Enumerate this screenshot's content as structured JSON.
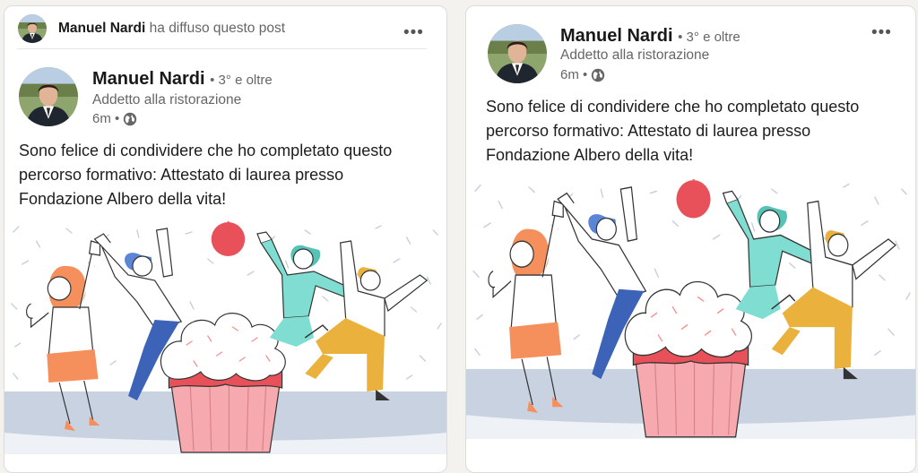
{
  "card1": {
    "repost": {
      "name": "Manuel Nardi",
      "action": "ha diffuso questo post"
    },
    "author": {
      "name": "Manuel Nardi",
      "degree": "• 3° e oltre",
      "headline": "Addetto alla ristorazione",
      "time": "6m •"
    },
    "text_lines": [
      "Sono felice di condividere che ho completato questo",
      "percorso formativo: Attestato di laurea presso",
      "Fondazione Albero della vita!"
    ],
    "more_label": "•••"
  },
  "card2": {
    "author": {
      "name": "Manuel Nardi",
      "degree": "• 3° e oltre",
      "headline": "Addetto alla ristorazione",
      "time": "6m •"
    },
    "text_lines": [
      "Sono felice di condividere che ho completato questo",
      "percorso formativo: Attestato di laurea presso",
      "Fondazione Albero della vita!"
    ],
    "more_label": "•••"
  },
  "icons": {
    "more": "more-horizontal-icon",
    "visibility": "globe-icon"
  },
  "colors": {
    "floor": "#c9d2e0",
    "cupcake_frosting": "#ffffff",
    "cupcake_base": "#f6a9ae",
    "cupcake_band": "#e8515a",
    "cherry": "#e8515a",
    "accent_orange": "#f58f5c",
    "accent_blue": "#3c63b8",
    "accent_teal": "#7fded1",
    "accent_yellow": "#eab13c"
  }
}
